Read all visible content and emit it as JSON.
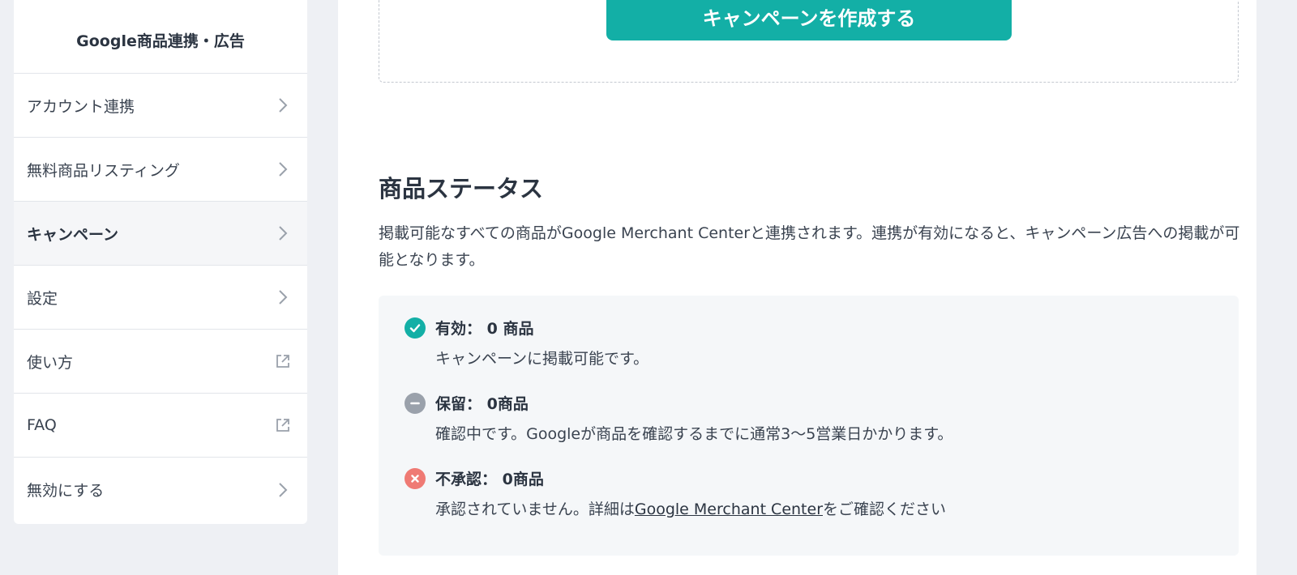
{
  "sidebar": {
    "title": "Google商品連携・広告",
    "items": [
      {
        "label": "アカウント連携",
        "icon": "chevron-right-icon"
      },
      {
        "label": "無料商品リスティング",
        "icon": "chevron-right-icon"
      },
      {
        "label": "キャンペーン",
        "icon": "chevron-right-icon",
        "active": true
      },
      {
        "label": "設定",
        "icon": "chevron-right-icon"
      },
      {
        "label": "使い方",
        "icon": "external-link-icon"
      },
      {
        "label": "FAQ",
        "icon": "external-link-icon"
      },
      {
        "label": "無効にする",
        "icon": "chevron-right-icon"
      }
    ]
  },
  "main": {
    "create_campaign_label": "キャンペーンを作成する",
    "product_status": {
      "title": "商品ステータス",
      "description": "掲載可能なすべての商品がGoogle Merchant Centerと連携されます。連携が有効になると、キャンペーン広告への掲載が可能となります。",
      "items": [
        {
          "label": "有効： 0 商品",
          "sub": "キャンペーンに掲載可能です。",
          "icon": "check-circle-icon",
          "color": "#13afa6"
        },
        {
          "label": "保留： 0商品",
          "sub": "確認中です。Googleが商品を確認するまでに通常3〜5営業日かかります。",
          "icon": "minus-circle-icon",
          "color": "#9aa1ab"
        },
        {
          "label": "不承認： 0商品",
          "sub_prefix": "承認されていません。詳細は",
          "sub_link": "Google Merchant Center",
          "sub_suffix": "をご確認ください",
          "icon": "x-circle-icon",
          "color": "#ef7a74"
        }
      ]
    }
  },
  "colors": {
    "accent": "#13afa6",
    "background": "#eef0f4",
    "text": "#2b3441"
  }
}
